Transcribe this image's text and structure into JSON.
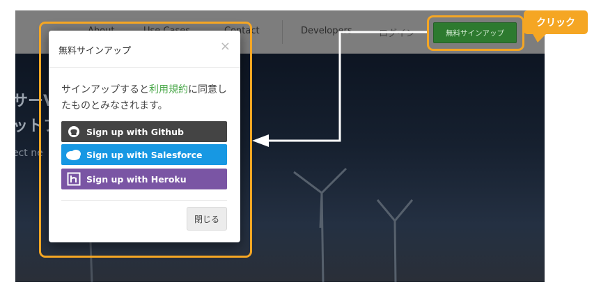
{
  "navbar": {
    "items": [
      "About",
      "Use Cases",
      "Contact",
      "Developers",
      "ログイン"
    ],
    "signup_label": "無料サインアップ"
  },
  "hero": {
    "line1": "サーV",
    "line2": "ットフ",
    "sub": "ect ne"
  },
  "modal": {
    "title": "無料サインアップ",
    "close_glyph": "×",
    "text_before": "サインアップすると",
    "text_link": "利用規約",
    "text_after": "に同意したものとみなされます。",
    "buttons": {
      "github": "Sign up with Github",
      "salesforce": "Sign up with Salesforce",
      "heroku": "Sign up with Heroku"
    },
    "close_label": "閉じる"
  },
  "annotation": {
    "label": "クリック",
    "color": "#f5a623"
  }
}
